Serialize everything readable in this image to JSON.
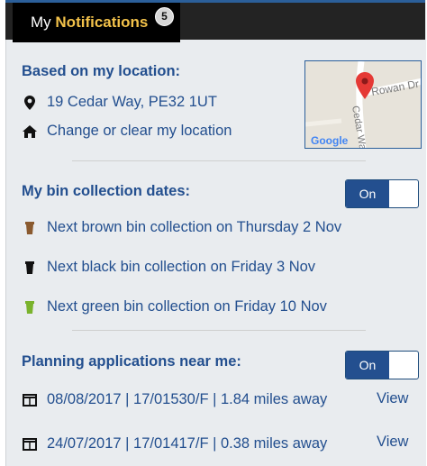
{
  "header": {
    "title_prefix": "My",
    "title_highlight": "Notifications",
    "badge_count": "5"
  },
  "location": {
    "heading": "Based on my location:",
    "address": "19 Cedar Way, PE32 1UT",
    "change_link": "Change or clear my location",
    "map": {
      "road1": "Rowan Dr",
      "road2": "Cedar Wa",
      "provider": "Google"
    }
  },
  "bins": {
    "heading": "My bin collection dates:",
    "toggle_label": "On",
    "items": [
      {
        "text": "Next brown bin collection on Thursday 2 Nov",
        "color": "#8a5a2f"
      },
      {
        "text": "Next black bin collection on Friday 3 Nov",
        "color": "#111111"
      },
      {
        "text": "Next green bin collection on Friday 10 Nov",
        "color": "#7ab32d"
      }
    ]
  },
  "planning": {
    "heading": "Planning applications near me:",
    "toggle_label": "On",
    "items": [
      {
        "text": "08/08/2017 | 17/01530/F | 1.84 miles away",
        "view_label": "View"
      },
      {
        "text": "24/07/2017 | 17/01417/F | 0.38 miles away",
        "view_label": "View"
      }
    ]
  },
  "colors": {
    "accent": "#234f8f",
    "header_bg": "#000000",
    "highlight": "#f3c24a"
  }
}
